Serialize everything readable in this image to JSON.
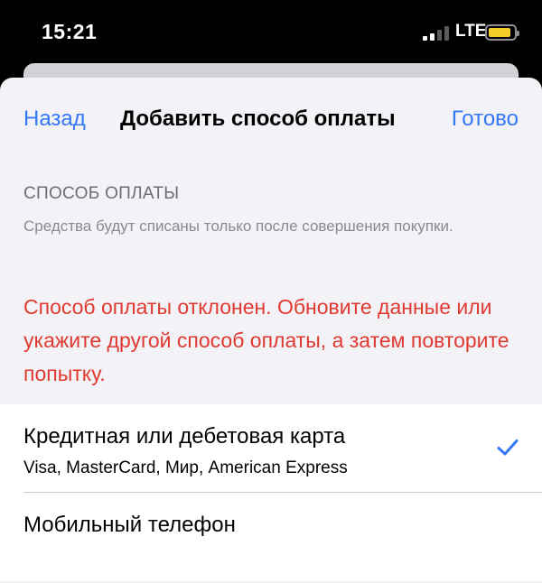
{
  "status_bar": {
    "time": "15:21",
    "network": "LTE",
    "signal_bars_active": 2,
    "signal_bars_total": 4,
    "battery_color": "#f4cf2b"
  },
  "navbar": {
    "back_label": "Назад",
    "title": "Добавить способ оплаты",
    "done_label": "Готово"
  },
  "section": {
    "header": "СПОСОБ ОПЛАТЫ",
    "note": "Средства будут списаны только после совершения покупки."
  },
  "error_message": "Способ оплаты отклонен. Обновите данные или укажите другой способ оплаты, а затем повторите попытку.",
  "payment_options": [
    {
      "title": "Кредитная или дебетовая карта",
      "subtitle": "Visa, MasterCard, Мир, American Express",
      "selected": true
    },
    {
      "title": "Мобильный телефон",
      "subtitle": "",
      "selected": false
    }
  ],
  "colors": {
    "accent": "#3478f6",
    "error": "#e03a30",
    "sheet_background": "#f2f2f7"
  },
  "icons": {
    "checkmark": "checkmark-icon",
    "signal": "cellular-signal-icon",
    "battery": "battery-icon"
  }
}
